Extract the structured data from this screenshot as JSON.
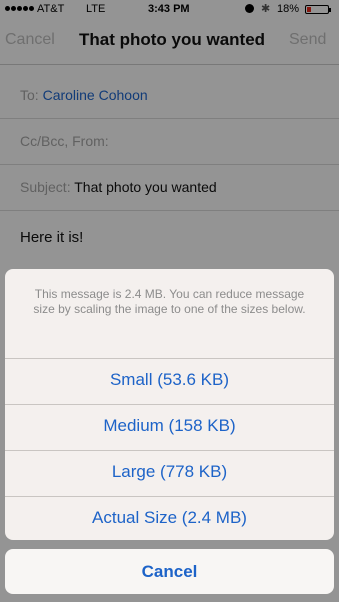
{
  "status_bar": {
    "carrier": "AT&T",
    "network": "LTE",
    "time": "3:43 PM",
    "battery_percent": "18%",
    "battery_level": 0.18,
    "battery_color": "#e0281a"
  },
  "nav": {
    "cancel_label": "Cancel",
    "title": "That photo you wanted",
    "send_label": "Send"
  },
  "compose": {
    "to_label": "To:",
    "to_value": "Caroline Cohoon",
    "cc_label": "Cc/Bcc, From:",
    "subject_label": "Subject:",
    "subject_value": "That photo you wanted",
    "body": "Here it is!"
  },
  "action_sheet": {
    "message": "This message is 2.4 MB. You can reduce message size by scaling the image to one of the sizes below.",
    "options": [
      {
        "label": "Small (53.6 KB)"
      },
      {
        "label": "Medium (158 KB)"
      },
      {
        "label": "Large (778 KB)"
      },
      {
        "label": "Actual Size (2.4 MB)"
      }
    ],
    "cancel_label": "Cancel"
  },
  "colors": {
    "accent": "#1d63c8"
  }
}
